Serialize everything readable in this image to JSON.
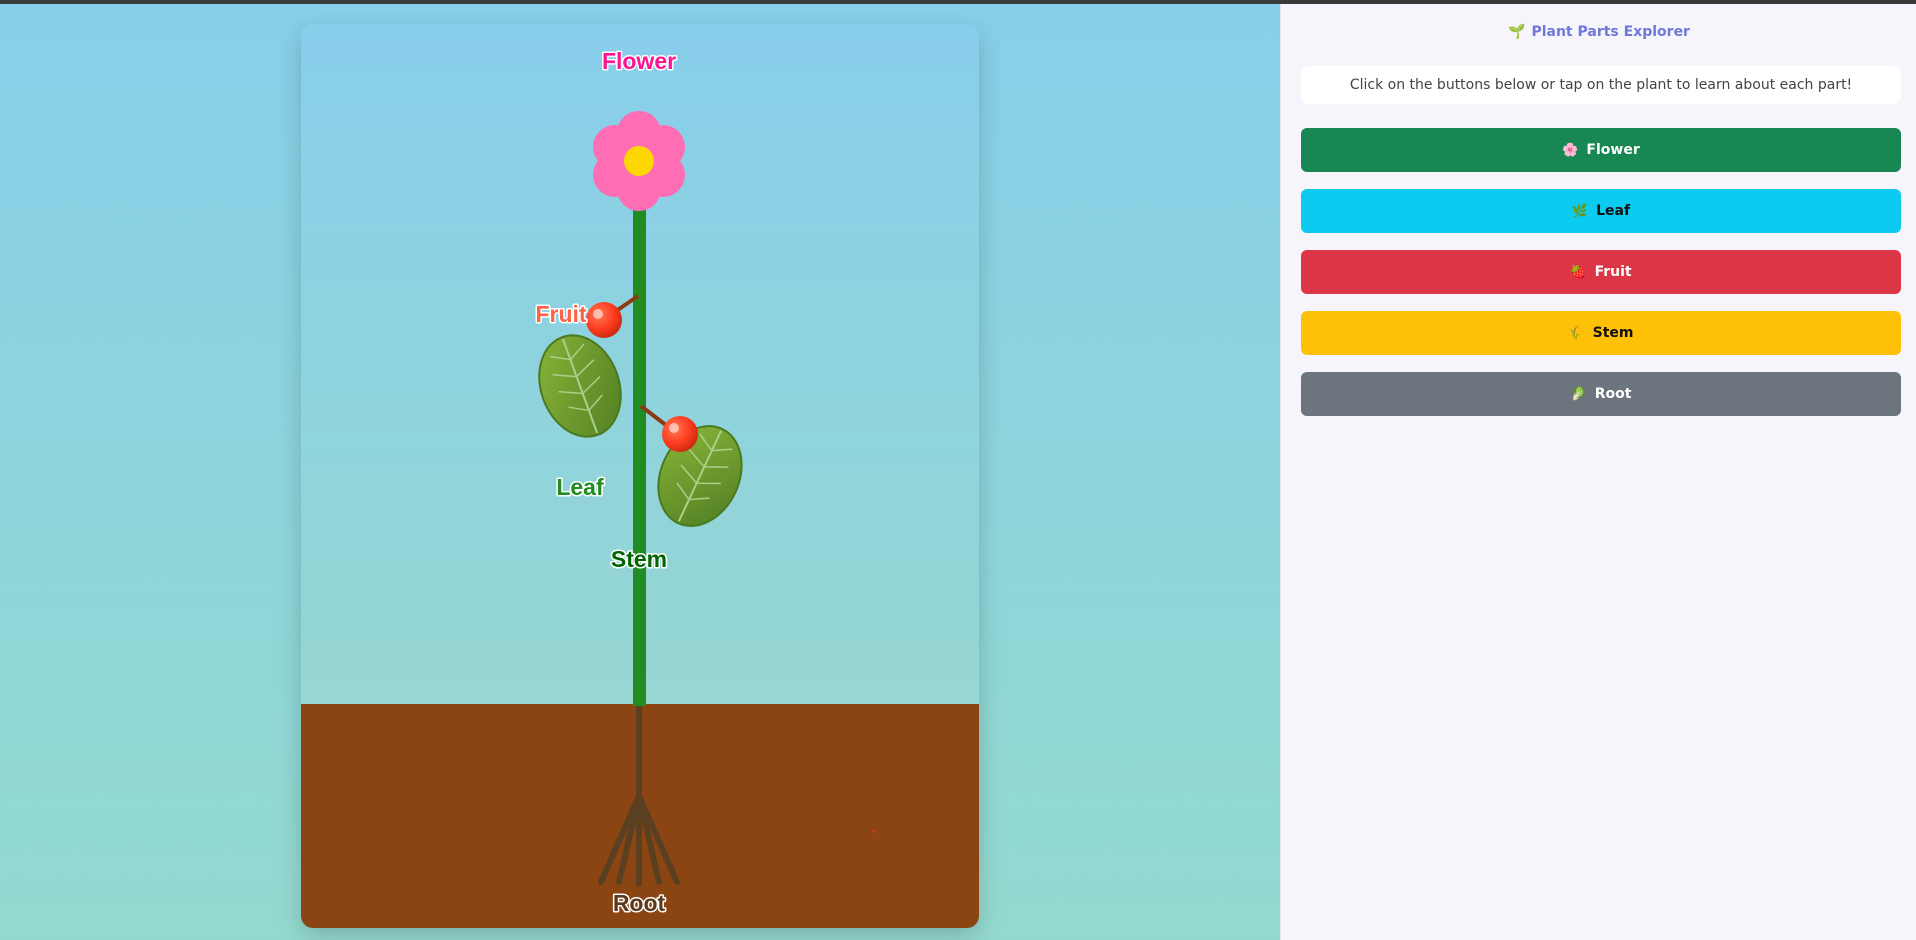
{
  "panel": {
    "title": "Plant Parts Explorer",
    "title_icon": "seedling-icon",
    "instructions": "Click on the buttons below or tap on the plant to learn about each part!"
  },
  "buttons": [
    {
      "label": "Flower",
      "icon": "flower-icon",
      "color": "#198754",
      "text_color": "#ffffff"
    },
    {
      "label": "Leaf",
      "icon": "leaf-icon",
      "color": "#0dcaf0",
      "text_color": "#111111"
    },
    {
      "label": "Fruit",
      "icon": "fruit-icon",
      "color": "#dc3545",
      "text_color": "#ffffff"
    },
    {
      "label": "Stem",
      "icon": "stem-icon",
      "color": "#ffc107",
      "text_color": "#111111"
    },
    {
      "label": "Root",
      "icon": "root-icon",
      "color": "#6c757d",
      "text_color": "#ffffff"
    }
  ],
  "plant_labels": {
    "flower": "Flower",
    "fruit": "Fruit",
    "leaf": "Leaf",
    "stem": "Stem",
    "root": "Root"
  },
  "colors": {
    "sky_top": "#87ceeb",
    "sky_bottom": "#97d8d0",
    "soil": "#8b4513",
    "stem": "#228b22",
    "root": "#5a4020",
    "petal": "#ff6eb4",
    "flower_center": "#ffd700",
    "fruit": "#ff3b1f",
    "leaf": "#6b9b2a",
    "label_flower": "#ff1493",
    "label_fruit": "#ff6347",
    "label_leaf": "#228b22",
    "label_stem": "#006400",
    "label_root": "#5a3a1a"
  }
}
